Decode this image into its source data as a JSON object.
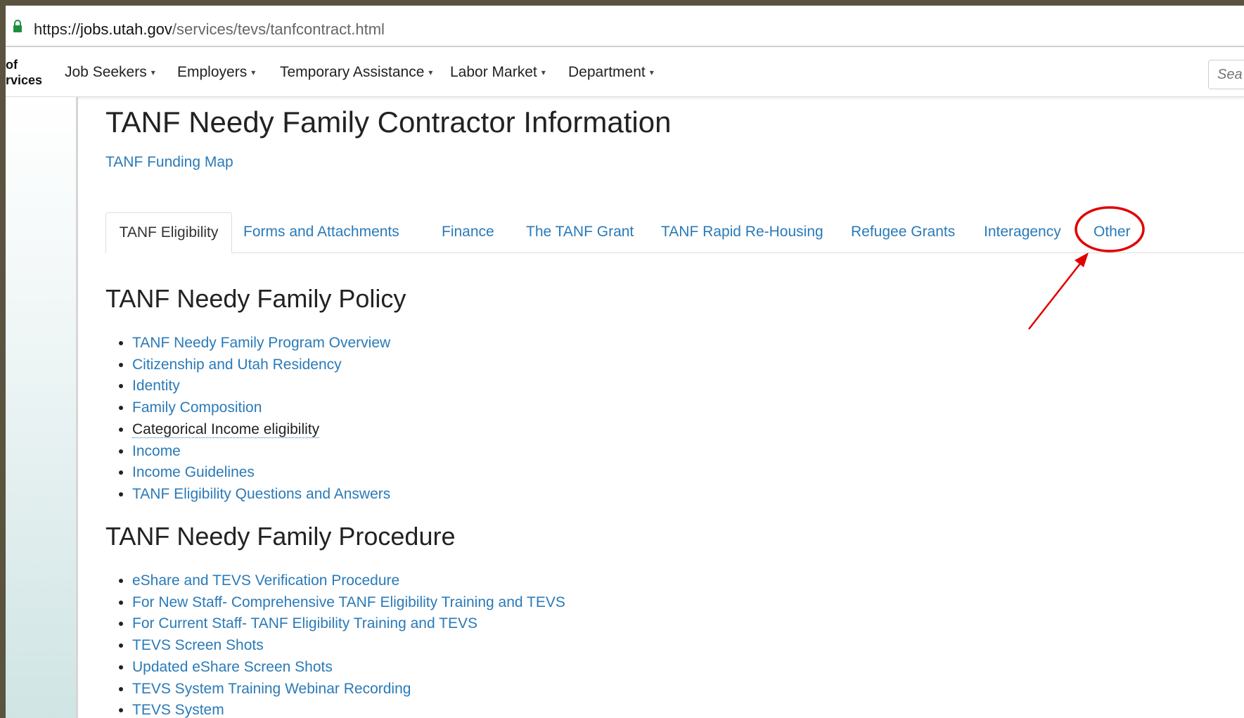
{
  "browser": {
    "url_scheme": "https://",
    "url_host": "jobs.utah.gov",
    "url_path": "/services/tevs/tanfcontract.html"
  },
  "site_nav": {
    "logo_lines": [
      "of",
      "rvices"
    ],
    "items": [
      {
        "label": "Job Seekers"
      },
      {
        "label": "Employers"
      },
      {
        "label": "Temporary Assistance"
      },
      {
        "label": "Labor Market"
      },
      {
        "label": "Department"
      }
    ],
    "search_placeholder": "Sea"
  },
  "page": {
    "title": "TANF Needy Family Contractor Information",
    "funding_link": "TANF Funding Map",
    "tabs": [
      {
        "label": "TANF Eligibility",
        "active": true
      },
      {
        "label": "Forms and Attachments"
      },
      {
        "label": "Finance"
      },
      {
        "label": "The TANF Grant"
      },
      {
        "label": "TANF Rapid Re-Housing"
      },
      {
        "label": "Refugee Grants"
      },
      {
        "label": "Interagency"
      },
      {
        "label": "Other"
      }
    ],
    "policy": {
      "heading": "TANF Needy Family Policy",
      "items": [
        "TANF Needy Family Program Overview",
        "Citizenship and Utah Residency",
        "Identity",
        "Family Composition",
        "Categorical Income eligibility",
        "Income",
        "Income Guidelines",
        "TANF Eligibility Questions and Answers"
      ]
    },
    "procedure": {
      "heading": "TANF Needy Family Procedure",
      "items": [
        "eShare and TEVS Verification Procedure",
        "For New Staff- Comprehensive TANF Eligibility Training and TEVS",
        "For Current Staff- TANF Eligibility Training and TEVS",
        "TEVS Screen Shots",
        "Updated eShare Screen Shots",
        "TEVS System Training Webinar Recording",
        "TEVS System"
      ]
    }
  },
  "colors": {
    "link": "#2a7ab8",
    "annotation": "#e00000",
    "lock": "#1e8e3e"
  }
}
